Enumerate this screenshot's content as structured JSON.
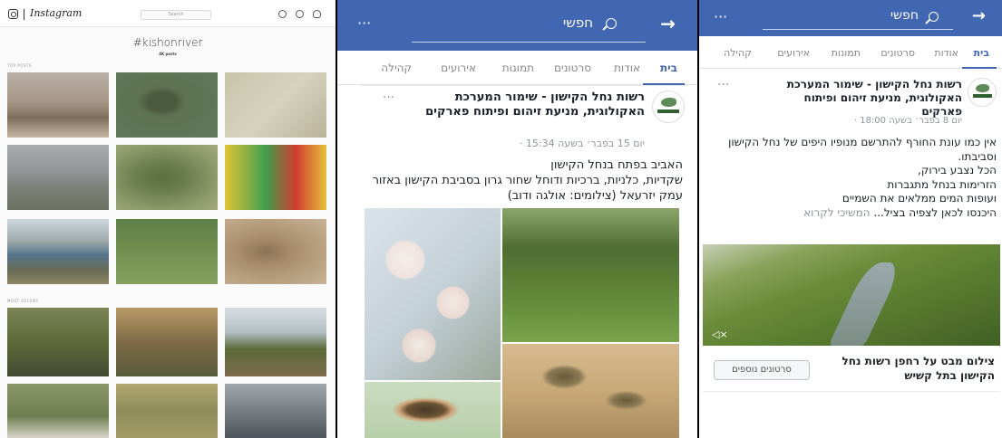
{
  "instagram": {
    "wordmark": "Instagram",
    "search_placeholder": "Search",
    "hashtag": "#kishonriver",
    "posts_count": "4K posts",
    "top_posts_label": "TOP POSTS",
    "most_recent_label": "MOST RECENT"
  },
  "fb_post_1": {
    "search_text": "חפשי",
    "tabs": [
      "בית",
      "אודות",
      "סרטונים",
      "תמונות",
      "אירועים",
      "קהילה"
    ],
    "author": "רשות נחל הקישון - שימור המערכת האקולוגית, מניעת זיהום ופיתוח פארקים",
    "timestamp": "יום 15 בפבר׳ בשעה 15:34 ·",
    "body": "האביב בפתח בנחל הקישון\nשקדיות, כלניות, ברכיות ודוחל שחור גרון בסביבת הקישון באזור עמק יזרעאל (צילומים: אולגה ודוב)"
  },
  "fb_post_2": {
    "search_text": "חפשי",
    "tabs": [
      "בית",
      "אודות",
      "סרטונים",
      "תמונות",
      "אירועים",
      "קהילה"
    ],
    "author": "רשות נחל הקישון - שימור המערכת האקולוגית, מניעת זיהום ופיתוח פארקים",
    "timestamp": "יום 8 בפבר׳ בשעה 18:00 ·",
    "body": "אין כמו עונת החורף להתרשם מנופיו היפים של נחל הקישון וסביבתו.\nהכל נצבע בירוק,\nהזרימות בנחל מתגברות\nועופות המים ממלאים את השמיים\nהיכנסו לכאן לצפיה בציל...",
    "see_more": "המשיכי לקרוא",
    "video_caption": "צילום מבט על רחפן רשות נחל הקישון בתל קשיש",
    "more_videos_button": "סרטונים נוספים"
  }
}
